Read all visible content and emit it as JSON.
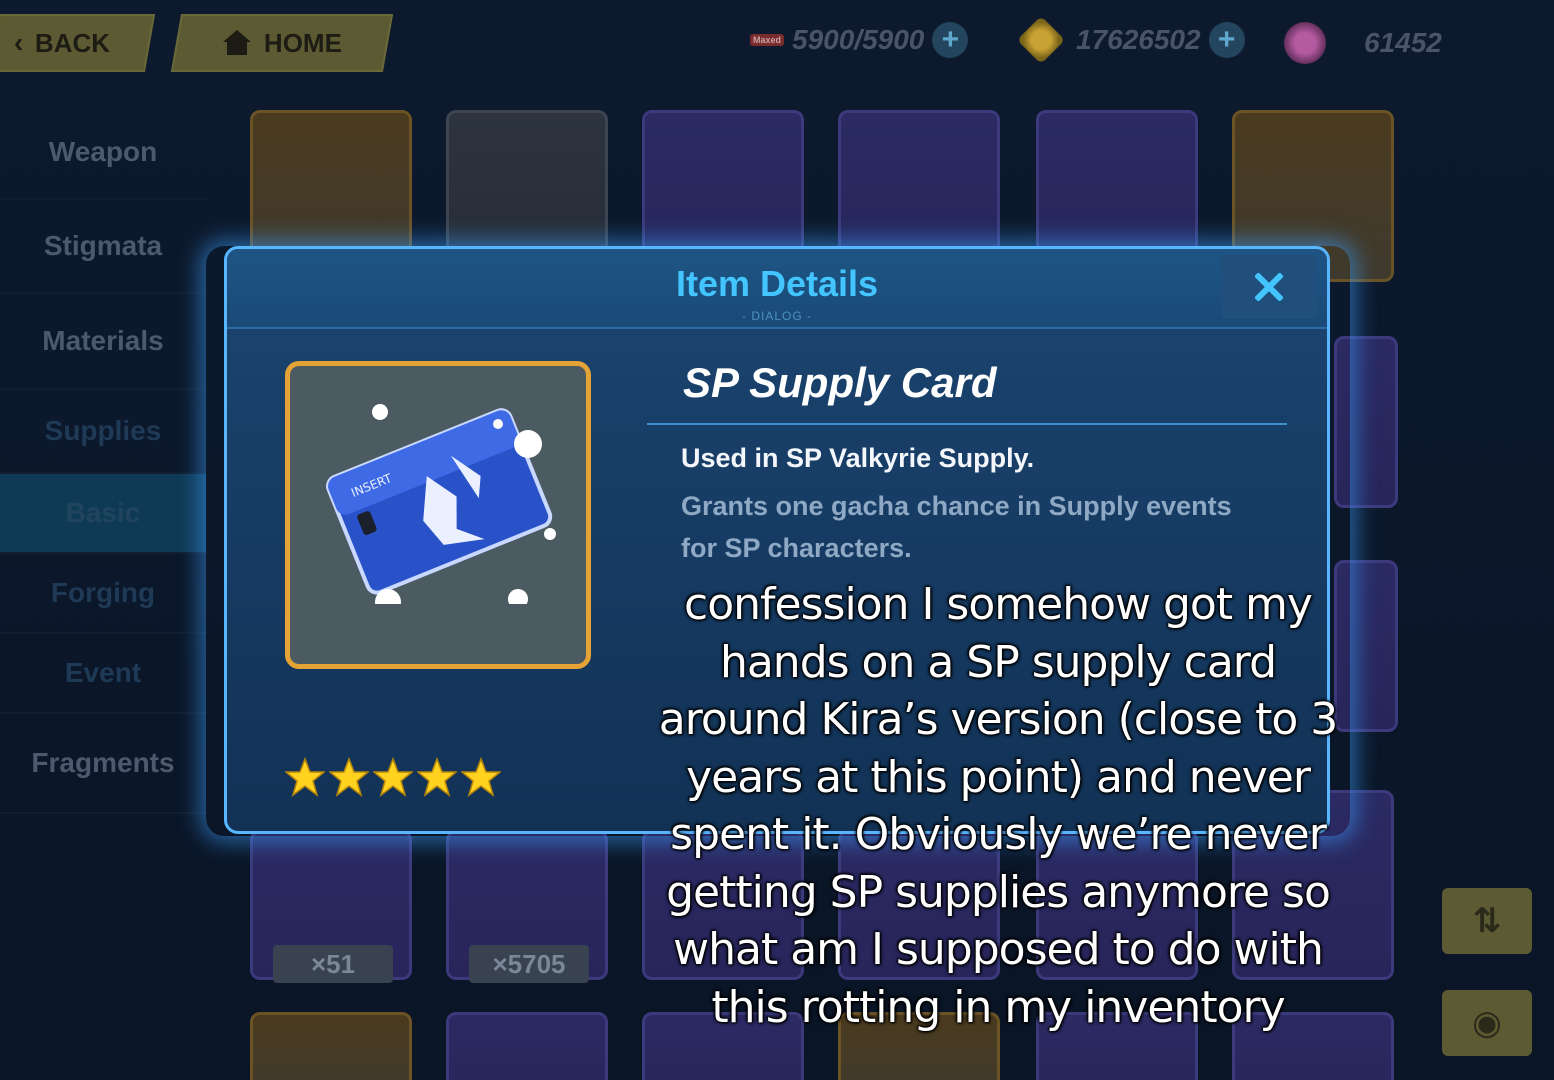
{
  "topbar": {
    "back_label": "BACK",
    "home_label": "HOME",
    "stamina": "5900/5900",
    "stamina_tag": "Maxed",
    "coins": "17626502",
    "crystals": "61452",
    "icons": [
      "back-chevron-icon",
      "home-icon",
      "stamina-icon",
      "coin-icon",
      "crystal-icon",
      "plus-icon"
    ]
  },
  "sidebar": {
    "items": [
      {
        "label": "Weapon"
      },
      {
        "label": "Stigmata"
      },
      {
        "label": "Materials"
      },
      {
        "label": "Supplies"
      },
      {
        "label": "Basic"
      },
      {
        "label": "Forging"
      },
      {
        "label": "Event"
      },
      {
        "label": "Fragments"
      }
    ],
    "active": "Basic"
  },
  "grid": {
    "visible_counts": [
      "×51",
      "×5705"
    ]
  },
  "dialog": {
    "title": "Item Details",
    "subtitle": "- DIALOG -",
    "item_name": "SP Supply Card",
    "description": "Used in SP Valkyrie Supply.",
    "detail_line1": "Grants one gacha chance in Supply events",
    "detail_line2": "for SP characters.",
    "rarity_stars": 5,
    "card_text": "INSERT",
    "colors": {
      "accent": "#43c6ff",
      "frame": "#e6a335",
      "star": "#ffd21f"
    }
  },
  "caption": {
    "lines": [
      "confession I somehow got my",
      "hands on a SP supply card",
      "around Kira’s version (close to 3",
      "years at this point) and never",
      "spent it. Obviously we’re never",
      "getting SP supplies anymore so",
      "what am I supposed to do with",
      "this rotting in my inventory"
    ]
  }
}
